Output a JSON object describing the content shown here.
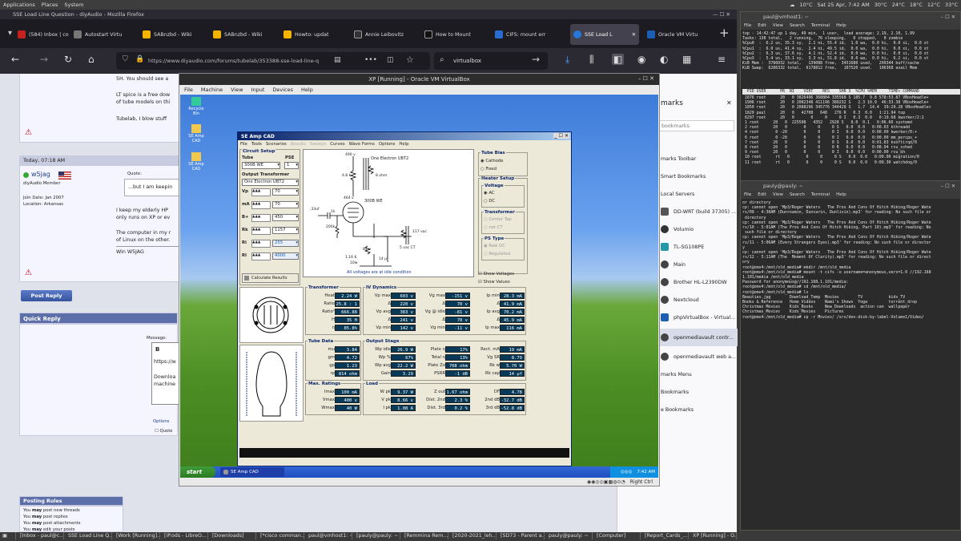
{
  "topbar": {
    "applications": "Applications",
    "places": "Places",
    "system": "System",
    "weather": "10°C",
    "datetime": "Sat 25 Apr, 7:42 AM",
    "temps": [
      "30°C",
      "24°C",
      "18°C",
      "12°C",
      "33°C"
    ]
  },
  "firefox": {
    "window_title": "SSE Load Line Question - diyAudio - Mozilla Firefox",
    "tabs": [
      {
        "label": "(584) Inbox | co",
        "color": "#c5221f"
      },
      {
        "label": "Autostart Virtu",
        "color": "#666"
      },
      {
        "label": "SABnzbd - Wiki",
        "color": "#f5b400"
      },
      {
        "label": "SABnzbd - Wiki",
        "color": "#f5b400"
      },
      {
        "label": "Howto: updat",
        "color": "#f5b400"
      },
      {
        "label": "Annie Leibovitz",
        "color": "#333"
      },
      {
        "label": "How to Mount",
        "color": "#222"
      },
      {
        "label": "CIFS: mount err",
        "color": "#2b6bd1"
      },
      {
        "label": "SSE Load L",
        "color": "#2677d8"
      },
      {
        "label": "Oracle VM Virtu",
        "color": "#1a5fb4"
      }
    ],
    "url": "https://www.diyaudio.com/forums/tubelab/353388-sse-load-line-q",
    "search_value": "virtualbox"
  },
  "forum": {
    "post1_lines": [
      "5H. You should see a",
      "LT spice is a free dow",
      "of tube models on thi",
      "Tubelab, I blow stuff"
    ],
    "post_date": "Today, 07:18 AM",
    "username": "w5jag",
    "user_title": "diyAudio Member",
    "join_date": "Join Date: Jan 2007",
    "location": "Location: Arkansas",
    "quote_label": "Quote:",
    "quote_text": "...but I am keepin",
    "body_lines": [
      "I keep my elderly HP",
      "only runs on XP or ev",
      "The computer in my r",
      "of Linux on the other."
    ],
    "signature": "Win W5JAG",
    "post_reply": "Post Reply",
    "quick_reply": "Quick Reply",
    "message_label": "Message:",
    "editor_text": [
      "https://w",
      "Downloa",
      "machine"
    ],
    "options_label": "Options",
    "quote_option": "Quote",
    "posting_rules_title": "Posting Rules",
    "rules": [
      {
        "b": "may",
        "pre": "You ",
        "post": " post new threads"
      },
      {
        "b": "may",
        "pre": "You ",
        "post": " post replies"
      },
      {
        "b": "may",
        "pre": "You ",
        "post": " post attachments"
      },
      {
        "b": "may",
        "pre": "You ",
        "post": " edit your posts"
      }
    ]
  },
  "sidebar": {
    "heading": "marks",
    "search_placeholder": "bookmarks",
    "items": [
      "marks Toolbar",
      "Smart Bookmarks",
      "Local Servers",
      "DD-WRT (build 37305) ...",
      "Volumio",
      "TL-SG108PE",
      "Main",
      "Brother HL-L2390DW",
      "Nextcloud",
      "phpVirtualBox - Virtual...",
      "openmediavault contr...",
      "openmediavault web a...",
      "marks Menu",
      "Bookmarks",
      "e Bookmarks"
    ]
  },
  "vbox": {
    "title": "XP [Running] - Oracle VM VirtualBox",
    "menu": [
      "File",
      "Machine",
      "View",
      "Input",
      "Devices",
      "Help"
    ],
    "status": "Right Ctrl"
  },
  "xp": {
    "icons": [
      "Recycle Bin",
      "SE Amp CAD",
      "SE Amp CAD"
    ],
    "start": "start",
    "task": "SE Amp CAD",
    "clock": "7:42 AM"
  },
  "seamp": {
    "title": "SE Amp CAD",
    "menu": [
      "File",
      "Tools",
      "Scenarios",
      "Results",
      "Sweeps",
      "Curves",
      "Wave Forms",
      "Options",
      "Help"
    ],
    "circuit_setup": "Circuit Setup",
    "tube_label": "Tube",
    "pse_label": "PSE",
    "tube_value": "300B WE",
    "pse_value": "1",
    "ot_label": "Output Transformer",
    "ot_value": "One Electron UBT2",
    "params": [
      {
        "k": "Vp",
        "v": "70"
      },
      {
        "k": "mA",
        "v": "70"
      },
      {
        "k": "B+",
        "v": "450"
      },
      {
        "k": "Rk",
        "v": "1157"
      },
      {
        "k": "Ri",
        "v": "255"
      },
      {
        "k": "Rl",
        "v": "4000"
      }
    ],
    "calc_btn": "Calculate Results",
    "schematic": {
      "b_plus": "490 v",
      "ot": "One Electron UBT2",
      "r1": "4.8 k",
      "r2": "8 ohm",
      "vp": "464 v",
      "tube": "300B WE",
      "cap": ".33uf",
      "rg": "1k",
      "r3": "200k",
      "heater": "117 vac",
      "heater2": "5 vac CT",
      "rk": "1.16 K",
      "rk_w": "10w",
      "vk": "81 v",
      "ck": "14 µf",
      "note": "All voltages are at idle condition"
    },
    "tube_bias": "Tube Bias",
    "cathode": "Cathode",
    "fixed": "Fixed",
    "heater_setup": "Heater Setup",
    "voltage": "Voltage",
    "ac": "AC",
    "dc": "DC",
    "transformer": "Transformer",
    "center_tap": "Center Tap",
    "not_ct": "not CT",
    "ps_type": "PS Type",
    "raw_dc": "Raw DC",
    "regulated": "Regulated",
    "show_voltages": "Show Voltages",
    "show_values": "Show Values",
    "transformer_box": {
      "title": "Transformer",
      "rows": [
        {
          "k": "Heat",
          "v": "2.24 W"
        },
        {
          "k": "Ratio",
          "v": "25.8 : 1"
        },
        {
          "k": "Ratio²",
          "v": "666.88"
        },
        {
          "k": "H",
          "v": "35 H"
        },
        {
          "k": "η",
          "v": "85.8%"
        }
      ]
    },
    "iv": {
      "title": "IV Dynamics",
      "rows": [
        [
          {
            "k": "Vp max",
            "v": "603 v"
          },
          {
            "k": "Vg max",
            "v": "-151 v"
          },
          {
            "k": "Ip min",
            "v": "28.3 mA"
          }
        ],
        [
          {
            "k": "Δ",
            "v": "220 v"
          },
          {
            "k": "Δ",
            "v": "70 v"
          },
          {
            "k": "Δ",
            "v": "41.9 mA"
          }
        ],
        [
          {
            "k": "Vp avg",
            "v": "383 v"
          },
          {
            "k": "Vg @ idle",
            "v": "-81 v"
          },
          {
            "k": "Ip avg",
            "v": "70.2 mA"
          }
        ],
        [
          {
            "k": "Δ",
            "v": "241 v"
          },
          {
            "k": "Δ",
            "v": "70 v"
          },
          {
            "k": "Δ",
            "v": "45.9 mA"
          }
        ],
        [
          {
            "k": "Vp min",
            "v": "142 v"
          },
          {
            "k": "Vg min",
            "v": "-11 v"
          },
          {
            "k": "Ip max",
            "v": "116 mA"
          }
        ]
      ]
    },
    "tube_data": {
      "title": "Tube Data",
      "rows": [
        {
          "k": "mu",
          "v": "3.84"
        },
        {
          "k": "gm",
          "v": "4.72 mA/v"
        },
        {
          "k": "gp",
          "v": "1.23 mA/v"
        },
        {
          "k": "rp",
          "v": "814 ohm"
        }
      ]
    },
    "output_stage": {
      "title": "Output Stage",
      "rows": [
        [
          {
            "k": "Wp idle",
            "v": "26.9 W"
          },
          {
            "k": "Plate η",
            "v": "17%"
          },
          {
            "k": "Rect. mA",
            "v": "19 mA"
          }
        ],
        [
          {
            "k": "Wp %",
            "v": "67%"
          },
          {
            "k": "Total η",
            "v": "13%"
          },
          {
            "k": "Vg SR",
            "v": "8.79 v/us"
          }
        ],
        [
          {
            "k": "Wp avg",
            "v": "22.2 W"
          },
          {
            "k": "Plate Zo",
            "v": "708 ohm"
          },
          {
            "k": "Rk w",
            "v": "5.70 W"
          }
        ],
        [
          {
            "k": "Gain",
            "v": "3.29"
          },
          {
            "k": "PSRR",
            "v": "-1 dB"
          },
          {
            "k": "Rk cap",
            "v": "14 µf"
          }
        ]
      ]
    },
    "max_ratings": {
      "title": "Max. Ratings",
      "rows": [
        {
          "k": "Imax",
          "v": "100 mA"
        },
        {
          "k": "Vmax",
          "v": "400 v"
        },
        {
          "k": "Wmax",
          "v": "40 W"
        }
      ]
    },
    "load": {
      "title": "Load",
      "rows": [
        [
          {
            "k": "W pk",
            "v": "9.37 W"
          },
          {
            "k": "Z out",
            "v": "1.67 ohm"
          },
          {
            "k": "DF",
            "v": "4.78"
          }
        ],
        [
          {
            "k": "V pk",
            "v": "8.66 v"
          },
          {
            "k": "Dist. 2nd",
            "v": "2.3 %"
          },
          {
            "k": "2nd dB",
            "v": "-32.7 dB"
          }
        ],
        [
          {
            "k": "I pk",
            "v": "1.08 A"
          },
          {
            "k": "Dist. 3rd",
            "v": "0.2 %"
          },
          {
            "k": "3rd dB",
            "v": "-52.8 dB"
          }
        ]
      ]
    }
  },
  "term1": {
    "title": "paul@vmhost1: ~",
    "menu": [
      "File",
      "Edit",
      "View",
      "Search",
      "Terminal",
      "Help"
    ],
    "lines": [
      "top - 14:42:47 up 1 day, 49 min,  1 user,  load average: 2.19, 2.10, 1.99",
      "Tasks: 138 total,   2 running,  76 sleeping,   0 stopped,   0 zombie",
      "%Cpu0  :  6.2 us, 35.3 sy,  2.1 ni, 55.4 id,  1.0 wa,  0.0 hi,  0.0 si,  0.0 st",
      "%Cpu1  :  6.0 us, 41.4 sy,  2.4 ni, 49.5 id,  0.0 wa,  0.0 hi,  0.0 si,  0.0 st",
      "%Cpu2  :  6.3 us, 37.6 sy,  4.1 ni, 52.4 id,  0.0 wa,  0.0 hi,  0.0 si,  0.0 st",
      "%Cpu3  :  5.4 us, 33.1 sy,  3.3 ni, 51.8 id,  0.0 wa,  0.0 hi,  6.2 si,  0.0 st",
      "KiB Mem :  3786032 total,   139088 free,  3451680 used,   209344 buff/cache",
      "KiB Swap:  6286332 total,  6178812 free,   107520 used.   106368 avail Mem",
      "",
      "  PID USER      PR  NI    VIRT    RES    SHR S  %CPU %MEM     TIME+ COMMAND",
      "10"
    ],
    "procs": [
      " 1876 root      20   0 3826496 368804 335568 S 185.7  9.8 578:53.87 VBoxHeadle+",
      " 1906 root      20   0 2082348 411196 389232 S   2.3 10.9  46:33.38 VBoxHeadle+",
      " 1850 root      20   0 2088296 345776 344428 S   1.7  14.4  39:29.28 VBoxHeadle+",
      " 1829 paul      20   0   42708   648   276 R   0.3  0.0   1:21.94 top",
      " 6297 root      20   0       0     0     0 I   0.3  0.0   0:19.68 kworker/2:2",
      " 1 root      20   0  225508   4352   2928 S   0.0  0.1   0:06.66 systemd",
      " 2 root      20   0       0     0     0 S   0.0  0.0   0:00.03 kthreadd",
      " 4 root       0 -20       0     0     0 I   0.0  0.0   0:00.00 kworker/0:+",
      " 6 root       0 -20       0     0     0 I   0.0  0.0   0:00.00 mm_percpu_+",
      " 7 root      20   0       0     0     0 S   0.0  0.0   0:01.83 ksoftirqd/0",
      " 8 root      20   0       0     0     0 R   0.0  0.0   0:08.94 rcu_sched",
      " 9 root      20   0       0     0     0 I   0.0  0.0   0:00.00 rcu_bh",
      " 10 root      rt   0       0     0     0 S   0.0  0.0   0:00.00 migration/0",
      " 11 root      rt   0       0     0     0 S   0.0  0.0   0:00.30 watchdog/0"
    ]
  },
  "term2": {
    "title": "pauly@pauly: ~",
    "menu": [
      "File",
      "Edit",
      "View",
      "Search",
      "Terminal",
      "Help"
    ],
    "lines": [
      "or directory",
      "cp: cannot open 'Mp3/Roger Waters   The Pros And Cons Of Hitch Hiking/Roger Wate",
      "rs/09 - 4:38AM (Dunroamin, Duncarin, Dunlivin).mp3' for reading: No such file or",
      " directory",
      "cp: cannot open 'Mp3/Roger Waters   The Pros And Cons Of Hitch Hiking/Roger Wate",
      "rs/10 - 5:01AM (The Pros And Cons Of Hitch Hiking, Part 10).mp3' for reading: No",
      " such file or directory",
      "cp: cannot open 'Mp3/Roger Waters   The Pros And Cons Of Hitch Hiking/Roger Wate",
      "rs/11 - 5:06AM (Every Strangers Eyes).mp3' for reading: No such file or director",
      "y",
      "cp: cannot open 'Mp3/Roger Waters   The Pros And Cons Of Hitch Hiking/Roger Wate",
      "rs/12 - 5:11AM (The  Moment Of Clarity).mp3' for reading: No such file or direct",
      "ory",
      "root@omv4:/mnt/old_media# mkdir /mnt/old_media",
      "root@omv4:/mnt/old_media# mount -t cifs -o username=anonymous,vers=1.0 //192.168",
      "1.101/media /mnt/old_media",
      "Password for anonymous@//192.168.1.101/media:",
      "root@omv4:/mnt/old_media# cd /mnt/old_media/",
      "root@omv4:/mnt/old_media# ls",
      "Beauties.jpg        Download_Temp  Movies        TV           kids_TV",
      "Books & Reference   Home_Videos    Nami's Shows  Yoga         torrent_drop",
      "Christmas Movies    Kids_Books     New_Downloads  action can  wallpaper",
      "Christmas_Movies    Kids_Movies    Pictures",
      "root@omv4:/mnt/old_media# cp -r Movies/ /srv/dev-disk-by-label-Volume1/Video/"
    ]
  },
  "taskbar": [
    "[Inbox - paul@c...",
    "SSE Load Line Q...",
    "[Work [Running]...",
    "[iP.ods - LibreO...",
    "[Downloads]",
    "[*cisco comman...",
    "paul@vmhost1: ~",
    "[pauly@pauly: ~",
    "[Remmina Rem...",
    "[2020-2021_leh...",
    "[SD73 - Parent a...",
    "pauly@pauly: ~",
    "[Computer]",
    "[Report_Cards_...",
    "XP [Running] - O..."
  ],
  "colors": {
    "accent": "#2677d8",
    "value_bg": "#073a58",
    "xp_sky": "#3d7bd9",
    "xp_grass": "#4c8e24"
  }
}
